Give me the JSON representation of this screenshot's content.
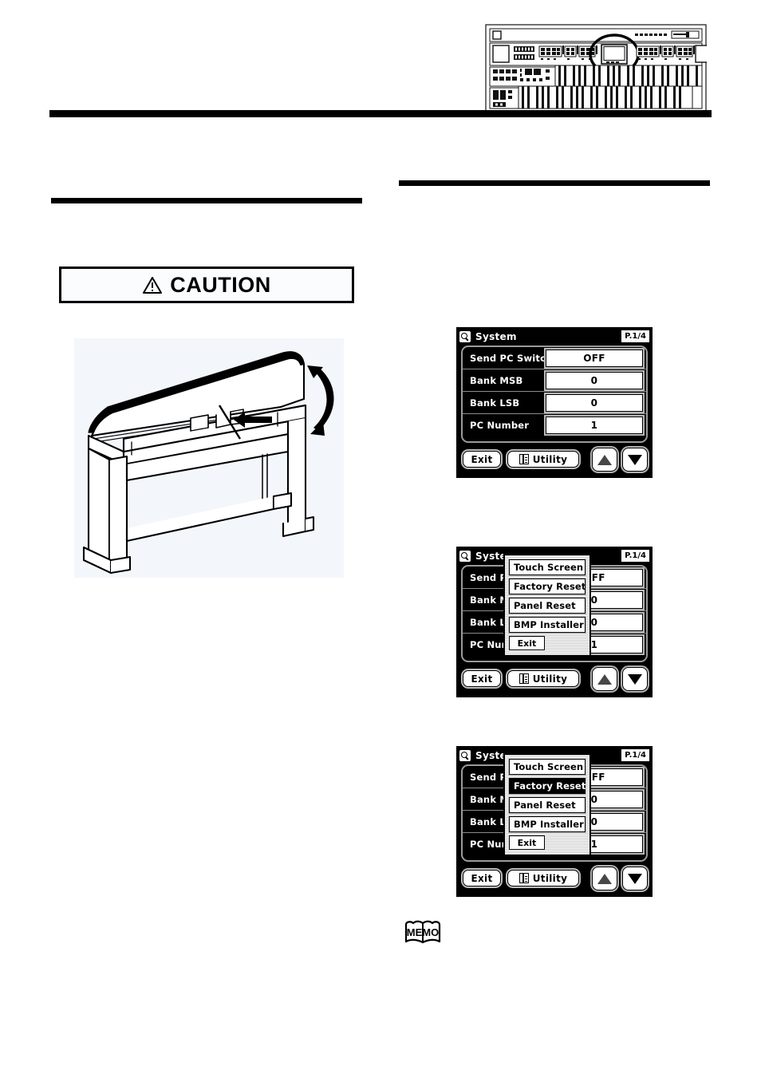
{
  "figures": {
    "organ_figure_name": "organ-console-diagram",
    "bench_figure_name": "bench-lid-diagram",
    "memo_icon": "memo-book-icon"
  },
  "caution": {
    "label": "CAUTION",
    "icon": "warning-triangle-icon"
  },
  "lcd_common": {
    "title": "System",
    "page": "P.1/4",
    "magnifier_icon": "magnifier-icon",
    "exit_label": "Exit",
    "utility_label": "Utility",
    "utility_icon": "list-document-icon",
    "nav_up_icon": "triangle-up-icon",
    "nav_down_icon": "triangle-down-icon",
    "rows": [
      {
        "label": "Send PC Switch",
        "value": "OFF"
      },
      {
        "label": "Bank MSB",
        "value": "0"
      },
      {
        "label": "Bank LSB",
        "value": "0"
      },
      {
        "label": "PC Number",
        "value": "1"
      }
    ]
  },
  "screens": [
    {
      "id": "system-page-1",
      "title": "System",
      "page": "P.1/4",
      "rows": [
        {
          "label": "Send PC Switch",
          "value": "OFF"
        },
        {
          "label": "Bank MSB",
          "value": "0"
        },
        {
          "label": "Bank LSB",
          "value": "0"
        },
        {
          "label": "PC Number",
          "value": "1"
        }
      ],
      "popup": null
    },
    {
      "id": "system-utility-menu-open",
      "title": "Syster",
      "page": "P.1/4",
      "rows": [
        {
          "label": "Send PC",
          "value": "OFF"
        },
        {
          "label": "Bank MS",
          "value": "0"
        },
        {
          "label": "Bank LS",
          "value": "0"
        },
        {
          "label": "PC Numb",
          "value": "1"
        }
      ],
      "popup": {
        "items": [
          "Touch Screen",
          "Factory Reset",
          "Panel Reset",
          "BMP Installer"
        ],
        "selected_index": -1,
        "exit_label": "Exit"
      }
    },
    {
      "id": "system-utility-factory-reset-selected",
      "title": "Syster",
      "page": "P.1/4",
      "rows": [
        {
          "label": "Send PC",
          "value": "OFF"
        },
        {
          "label": "Bank MS",
          "value": "0"
        },
        {
          "label": "Bank LS",
          "value": "0"
        },
        {
          "label": "PC Numb",
          "value": "1"
        }
      ],
      "popup": {
        "items": [
          "Touch Screen",
          "Factory Reset",
          "Panel Reset",
          "BMP Installer"
        ],
        "selected_index": 1,
        "exit_label": "Exit"
      }
    }
  ],
  "colors": {
    "lcd_background": "#000000",
    "lcd_foreground": "#ffffff",
    "rule": "#000000",
    "illustration_background": "#f3f7fb"
  }
}
